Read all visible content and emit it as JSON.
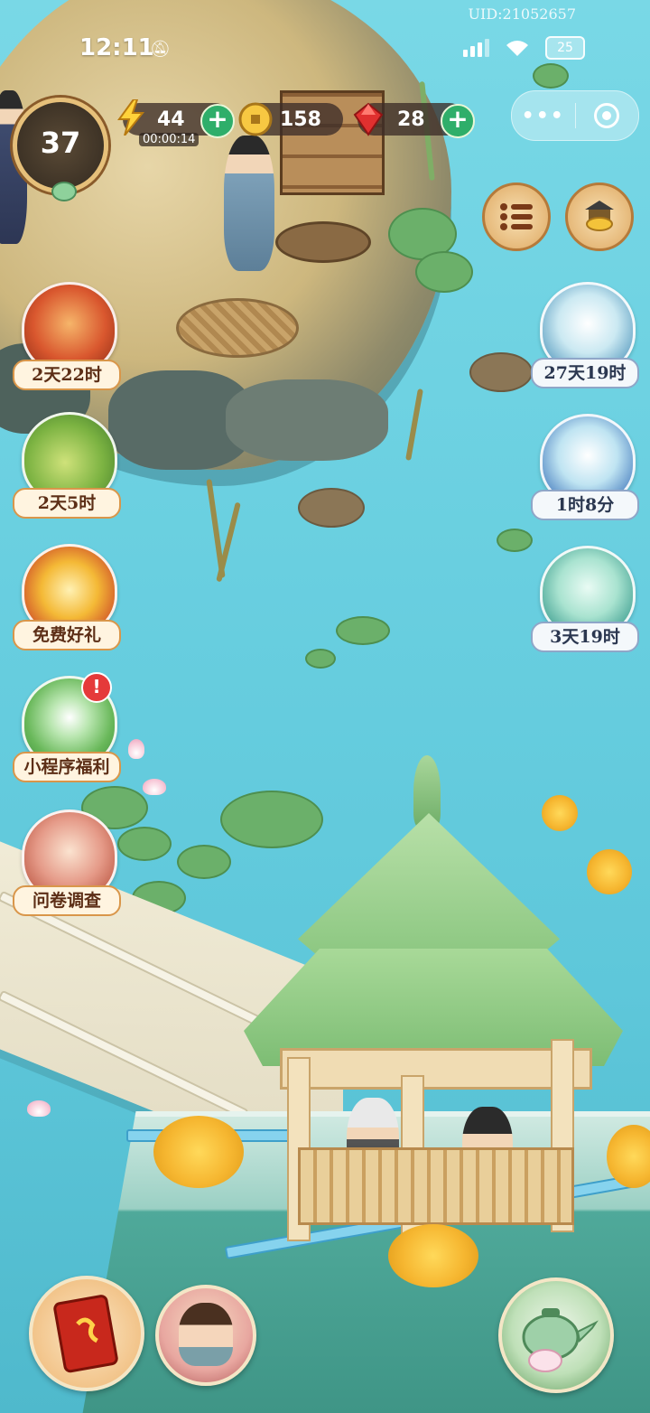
{
  "status_bar": {
    "time": "12:11",
    "uid": "UID:21052657",
    "battery": "25"
  },
  "capsule": {
    "more_label": "•••"
  },
  "player": {
    "level": "37"
  },
  "resources": {
    "energy": {
      "value": "44",
      "timer": "00:00:14"
    },
    "coins": {
      "value": "158"
    },
    "gems": {
      "value": "28"
    }
  },
  "left_events": [
    {
      "label": "2天22时"
    },
    {
      "label": "2天5时"
    },
    {
      "label": "免费好礼"
    },
    {
      "label": "小程序福利",
      "badge": "!"
    },
    {
      "label": "问卷调查"
    }
  ],
  "right_events": [
    {
      "label": "27天19时"
    },
    {
      "label": "1时8分"
    },
    {
      "label": "3天19时"
    }
  ],
  "icons": {
    "energy": "lightning-icon",
    "coin": "coin-icon",
    "gem": "gem-icon",
    "menu": "list-menu-icon",
    "shop": "treasure-shop-icon"
  },
  "colors": {
    "water": "#6fd3e3",
    "plus_button": "#2fae6a",
    "badge": "#e53a3a",
    "label_border": "#d9964a"
  }
}
